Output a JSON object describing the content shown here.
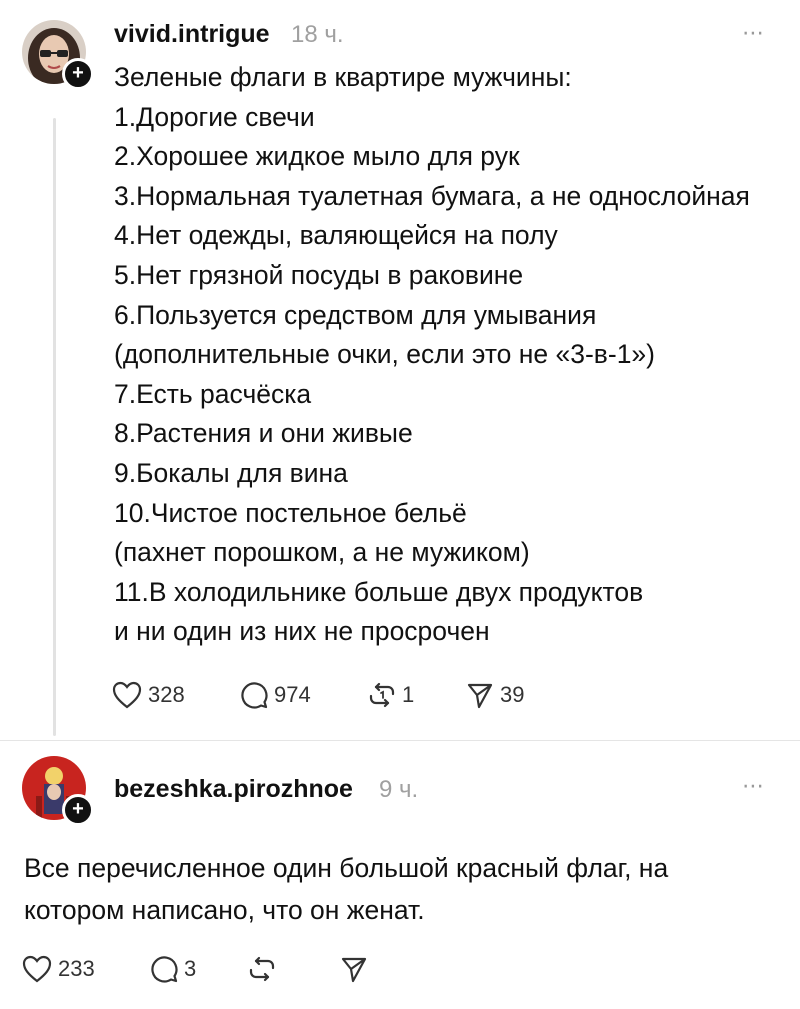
{
  "posts": [
    {
      "username": "vivid.intrigue",
      "time": "18 ч.",
      "lines": [
        "Зеленые флаги в квартире мужчины:",
        "1.Дорогие свечи",
        "2.Хорошее жидкое мыло для рук",
        "3.Нормальная туалетная бумага, а не однослойная",
        "4.Нет одежды, валяющейся на полу",
        "5.Нет грязной посуды в раковине",
        "6.Пользуется средством для умывания",
        "(дополнительные очки, если это не «3-в-1»)",
        "7.Есть расчёска",
        "8.Растения и они живые",
        "9.Бокалы для вина",
        "10.Чистое постельное бельё",
        "(пахнет порошком, а не мужиком)",
        "11.В холодильнике больше двух продуктов",
        "и ни один из них не просрочен"
      ],
      "likes": "328",
      "comments": "974",
      "reposts": "1",
      "shares": "39"
    },
    {
      "username": "bezeshka.pirozhnoe",
      "time": "9 ч.",
      "lines": [
        "Все перечисленное один большой красный флаг, на",
        "котором написано, что он женат."
      ],
      "likes": "233",
      "comments": "3",
      "reposts": "",
      "shares": ""
    }
  ],
  "icons": {
    "like": "heart-icon",
    "comment": "comment-bubble-icon",
    "repost": "repost-icon",
    "share": "send-icon",
    "follow": "plus-icon",
    "menu": "more-dots-icon"
  },
  "colors": {
    "text": "#111111",
    "muted": "#a0a0a0",
    "thread_line": "#e2e2e2"
  }
}
